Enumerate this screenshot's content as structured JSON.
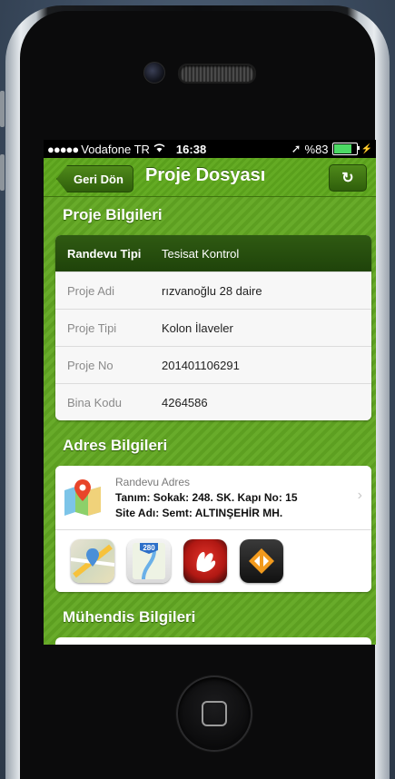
{
  "statusbar": {
    "carrier": "Vodafone TR",
    "time": "16:38",
    "battery": "%83"
  },
  "navbar": {
    "back_label": "Geri Dön",
    "title": "Proje Dosyası"
  },
  "project_section": {
    "title": "Proje Bilgileri",
    "rows": [
      {
        "label": "Randevu Tipi",
        "value": "Tesisat Kontrol"
      },
      {
        "label": "Proje Adi",
        "value": "rızvanoğlu 28 daire"
      },
      {
        "label": "Proje Tipi",
        "value": "Kolon  İlaveler"
      },
      {
        "label": "Proje No",
        "value": "201401106291"
      },
      {
        "label": "Bina Kodu",
        "value": "4264586"
      }
    ]
  },
  "address_section": {
    "title": "Adres Bilgileri",
    "heading": "Randevu Adres",
    "line1": "Tanım:  Sokak: 248. SK. Kapı No: 15",
    "line2": "Site Adı:  Semt: ALTINŞEHİR MH.",
    "nav_apps": [
      "apple-maps",
      "google-maps",
      "tomtom",
      "navigon"
    ],
    "google_maps_badge": "280"
  },
  "engineer_section": {
    "title": "Mühendis Bilgileri"
  },
  "colors": {
    "accent_green": "#5f9e22",
    "header_row": "#2f5a12"
  }
}
